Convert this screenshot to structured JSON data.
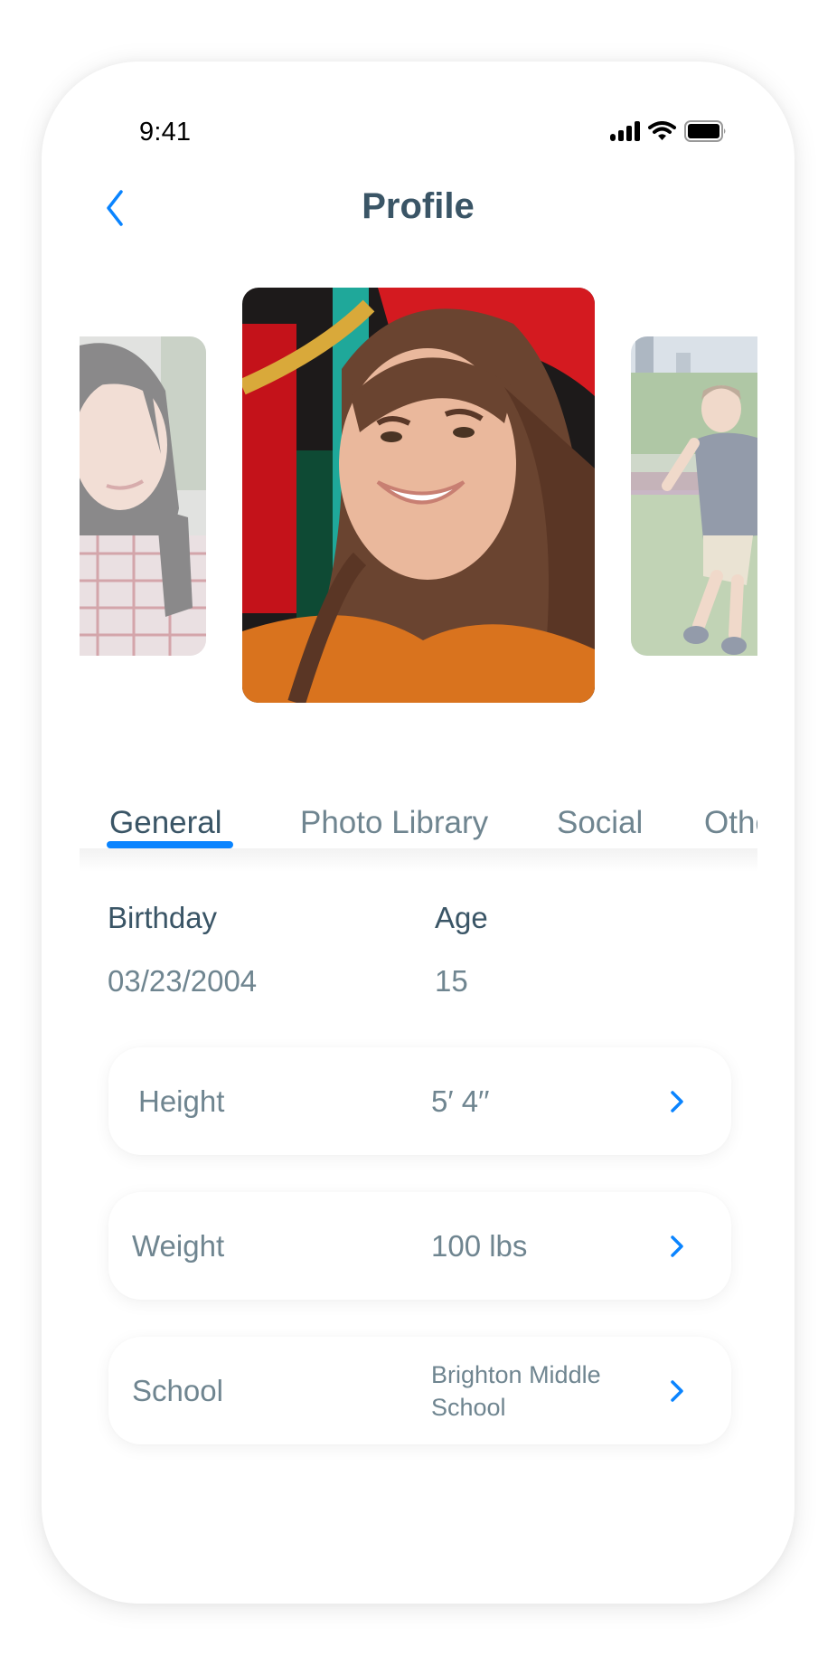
{
  "status_bar": {
    "time": "9:41",
    "icons": [
      "signal-icon",
      "wifi-icon",
      "battery-icon"
    ]
  },
  "header": {
    "title": "Profile",
    "back_icon": "chevron-left-icon"
  },
  "photos": [
    {
      "name": "photo-previous",
      "subject": "woman in plaid shirt"
    },
    {
      "name": "photo-current",
      "subject": "smiling young woman"
    },
    {
      "name": "photo-next",
      "subject": "boy running on grass"
    }
  ],
  "tabs": [
    {
      "label": "General",
      "active": true
    },
    {
      "label": "Photo Library",
      "active": false
    },
    {
      "label": "Social",
      "active": false
    },
    {
      "label": "Other",
      "active": false
    }
  ],
  "general": {
    "birthday_label": "Birthday",
    "birthday_value": "03/23/2004",
    "age_label": "Age",
    "age_value": "15"
  },
  "rows": [
    {
      "label": "Height",
      "value": "5′ 4′′"
    },
    {
      "label": "Weight",
      "value": "100 lbs"
    },
    {
      "label": "School",
      "value": "Brighton Middle School"
    }
  ],
  "colors": {
    "accent": "#0a84ff",
    "title": "#3a5566",
    "muted": "#6f8590"
  }
}
